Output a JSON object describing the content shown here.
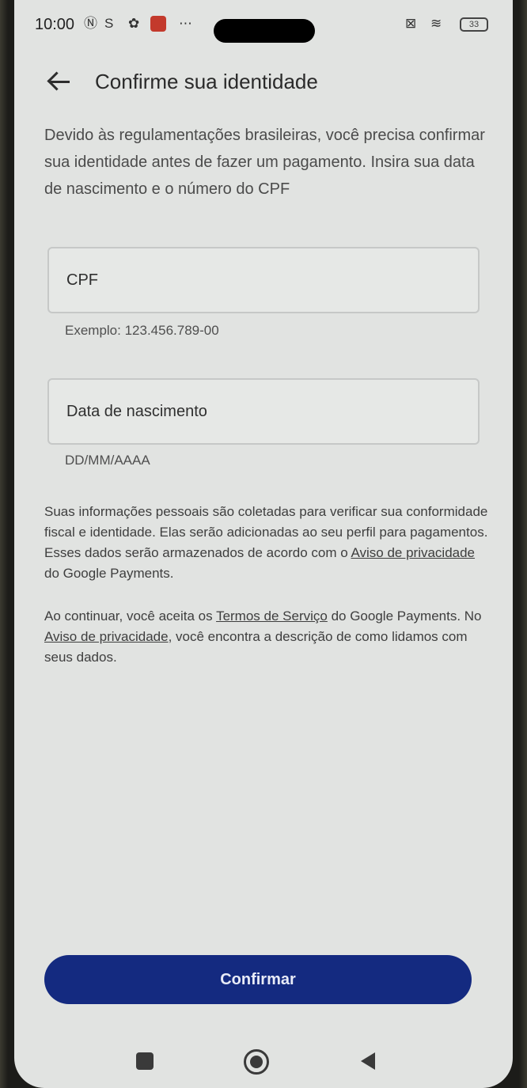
{
  "status_bar": {
    "time": "10:00",
    "icons": [
      "nfc-icon",
      "s-icon",
      "gear-icon",
      "app-notification-icon",
      "more-icon",
      "sim-off-icon",
      "wifi-icon"
    ],
    "battery": "33"
  },
  "header": {
    "back_icon": "arrow-left-icon",
    "title": "Confirme sua identidade"
  },
  "intro_text": "Devido às regulamentações brasileiras, você precisa confirmar sua identidade antes de fazer um pagamento. Insira sua data de nascimento e o número do CPF",
  "fields": [
    {
      "placeholder": "CPF",
      "helper": "Exemplo: 123.456.789-00"
    },
    {
      "placeholder": "Data de nascimento",
      "helper": "DD/MM/AAAA"
    }
  ],
  "privacy": {
    "p1_before": "Suas informações pessoais são coletadas para verificar sua conformidade fiscal e identidade. Elas serão adicionadas ao seu perfil para pagamentos. Esses dados serão armazenados de acordo com o ",
    "p1_link": "Aviso de privacidade",
    "p1_after": " do Google Payments.",
    "p2_before": "Ao continuar, você aceita os ",
    "p2_link1": "Termos de Serviço",
    "p2_mid": " do Google Payments. No ",
    "p2_link2": "Aviso de privacidade",
    "p2_after": ", você encontra a descrição de como lidamos com seus dados."
  },
  "confirm_button": "Confirmar",
  "colors": {
    "background": "#e1e3e1",
    "primary_button": "#142a80",
    "text": "#3e3e3e"
  },
  "nav_bar": [
    "recent-apps-icon",
    "home-icon",
    "back-triangle-icon"
  ]
}
